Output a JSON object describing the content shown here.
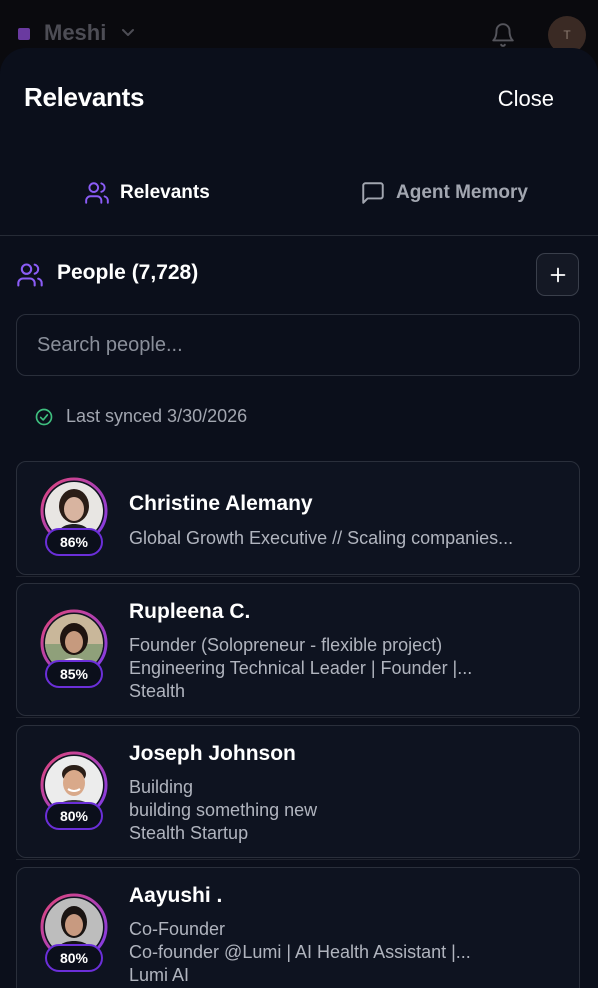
{
  "app": {
    "name": "Meshi",
    "avatar_initial": "T"
  },
  "panel": {
    "title": "Relevants",
    "close_label": "Close",
    "tabs": [
      {
        "label": "Relevants",
        "icon": "users-icon",
        "active": true
      },
      {
        "label": "Agent Memory",
        "icon": "chat-icon",
        "active": false
      }
    ],
    "people_title": "People (7,728)",
    "search_placeholder": "Search people...",
    "sync_text": "Last synced 3/30/2026"
  },
  "people": [
    {
      "name": "Christine Alemany",
      "match": "86%",
      "lines": [
        "Global Growth Executive // Scaling companies..."
      ]
    },
    {
      "name": "Rupleena C.",
      "match": "85%",
      "lines": [
        "Founder (Solopreneur - flexible project)",
        "Engineering Technical Leader | Founder |...",
        "Stealth"
      ]
    },
    {
      "name": "Joseph Johnson",
      "match": "80%",
      "lines": [
        "Building",
        "building something new",
        "Stealth Startup"
      ]
    },
    {
      "name": "Aayushi .",
      "match": "80%",
      "lines": [
        "Co-Founder",
        "Co-founder @Lumi | AI Health Assistant |...",
        "Lumi AI"
      ]
    }
  ],
  "colors": {
    "accent": "#8b5cf6",
    "ring_start": "#e0467a",
    "ring_end": "#7c3aed",
    "sync_check": "#3fbf7f"
  }
}
